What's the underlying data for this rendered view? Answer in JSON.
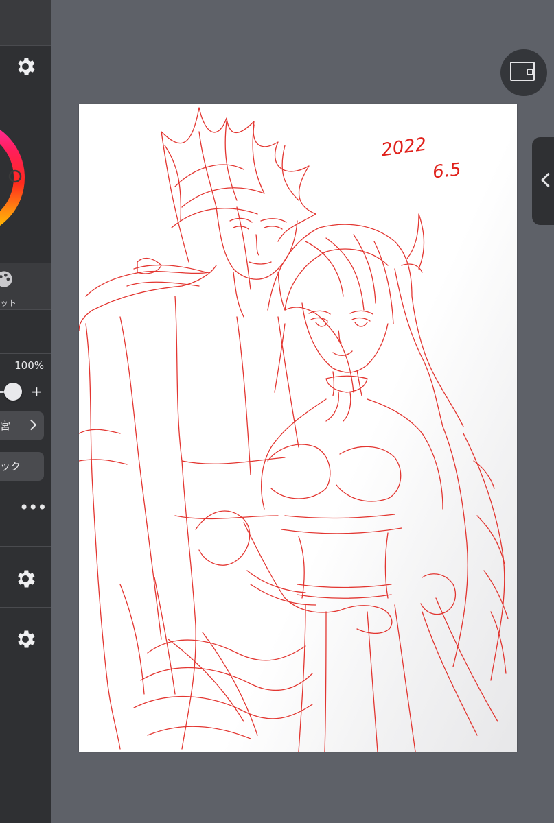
{
  "canvas": {
    "annotation_year": "2022",
    "annotation_date": "6.5"
  },
  "side_panel": {
    "palette_label": "ット",
    "opacity_value": "100%",
    "plus_label": "+",
    "row_button_1": "宮",
    "row_button_2": "ック",
    "more_label": "•••"
  },
  "icons": {
    "settings": "gear-icon",
    "color": "color-wheel",
    "palette": "palette-icon",
    "view": "view-toggle-icon",
    "drawer": "chevron-left-icon"
  },
  "colors": {
    "sketch_line": "#e0211b",
    "panel_bg": "#2f3033",
    "workspace_bg": "#5e6168"
  }
}
